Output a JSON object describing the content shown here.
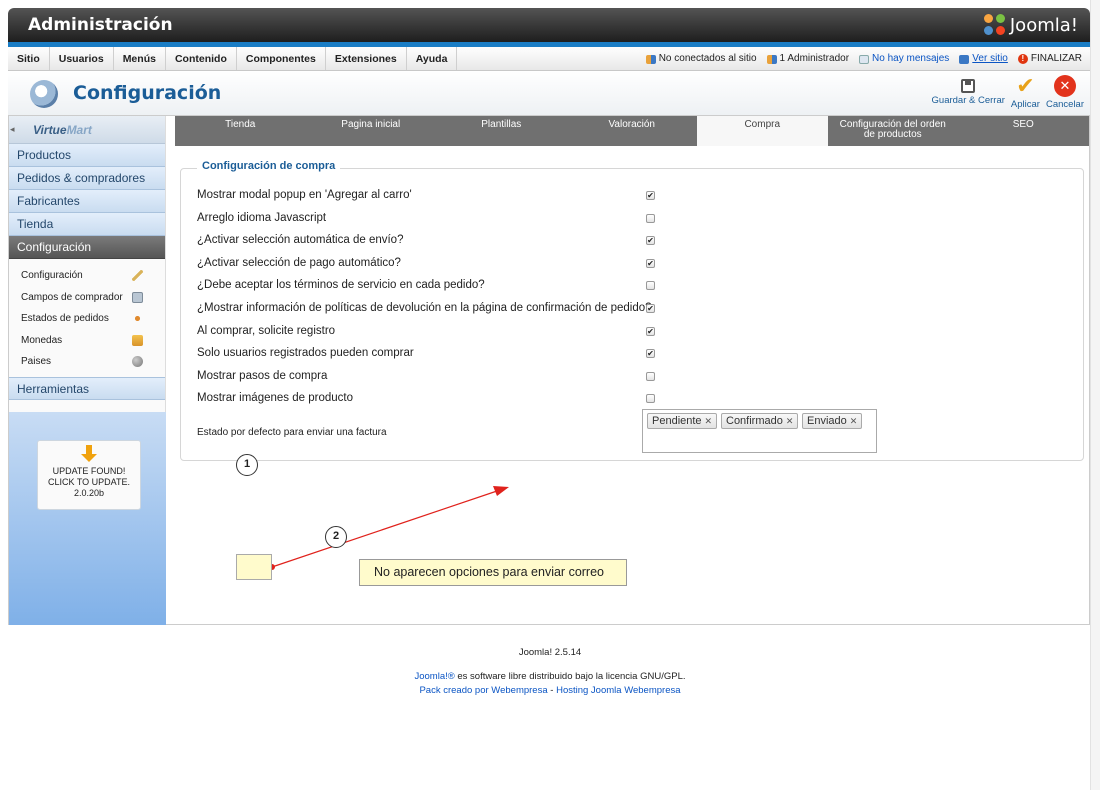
{
  "header": {
    "title": "Administración",
    "brand": "Joomla!"
  },
  "menu": {
    "items": [
      "Sitio",
      "Usuarios",
      "Menús",
      "Contenido",
      "Componentes",
      "Extensiones",
      "Ayuda"
    ],
    "status": {
      "visitors": "No conectados al sitio",
      "admins": "1 Administrador",
      "messages": "No hay mensajes",
      "view_site": "Ver sitio",
      "logout": "FINALIZAR"
    }
  },
  "toolbar": {
    "title": "Configuración",
    "save_close": "Guardar & Cerrar",
    "apply": "Aplicar",
    "cancel": "Cancelar"
  },
  "sidebar": {
    "logo": {
      "main": "Virtue",
      "accent": "Mart"
    },
    "sections": [
      "Productos",
      "Pedidos & compradores",
      "Fabricantes",
      "Tienda",
      "Configuración"
    ],
    "sub_items": [
      "Configuración",
      "Campos de comprador",
      "Estados de pedidos",
      "Monedas",
      "Paises"
    ],
    "tools": "Herramientas",
    "update": {
      "line1": "UPDATE FOUND!",
      "line2": "CLICK TO UPDATE.",
      "version": "2.0.20b"
    }
  },
  "tabs": [
    {
      "line1": "Tienda",
      "line2": ""
    },
    {
      "line1": "Pagina inicial",
      "line2": ""
    },
    {
      "line1": "Plantillas",
      "line2": ""
    },
    {
      "line1": "Valoración",
      "line2": ""
    },
    {
      "line1": "Compra",
      "line2": ""
    },
    {
      "line1": "Configuración del orden",
      "line2": "de productos"
    },
    {
      "line1": "SEO",
      "line2": ""
    }
  ],
  "purchase": {
    "legend": "Configuración de compra",
    "options": [
      {
        "label": "Mostrar modal popup en 'Agregar al carro'",
        "checked": "✔"
      },
      {
        "label": "Arreglo idioma Javascript",
        "checked": ""
      },
      {
        "label": "¿Activar selección automática de envío?",
        "checked": "✔"
      },
      {
        "label": "¿Activar selección de pago automático?",
        "checked": "✔"
      },
      {
        "label": "¿Debe aceptar los términos de servicio en cada pedido?",
        "checked": ""
      },
      {
        "label": "¿Mostrar información de políticas de devolución en la página de confirmación de pedido?",
        "checked": "✔"
      },
      {
        "label": "Al comprar, solicite registro",
        "checked": "✔"
      },
      {
        "label": "Solo usuarios registrados pueden comprar",
        "checked": "✔"
      },
      {
        "label": "Mostrar pasos de compra",
        "checked": ""
      },
      {
        "label": "Mostrar imágenes de producto",
        "checked": ""
      }
    ],
    "invoice_label": "Estado por defecto para enviar una factura",
    "invoice_states": [
      "Pendiente",
      "Confirmado",
      "Enviado"
    ]
  },
  "annotations": {
    "callout1": "1",
    "callout2": "2",
    "note": "No aparecen opciones para enviar correo",
    "arrow_color": "#e0221c"
  },
  "footer": {
    "version": "Joomla! 2.5.14",
    "license_link": "Joomla!®",
    "license_text": " es software libre distribuido bajo la licencia GNU/GPL.",
    "pack_text": "Pack creado por ",
    "pack_link": "Webempresa",
    "sep": " - ",
    "hosting_link": "Hosting Joomla Webempresa"
  }
}
